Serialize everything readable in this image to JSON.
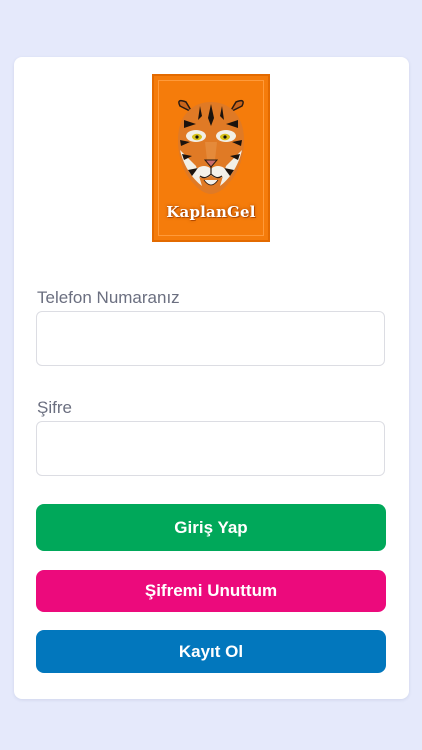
{
  "logo": {
    "text": "KaplanGel",
    "icon": "tiger-logo-icon",
    "bg_color": "#f57c0b"
  },
  "form": {
    "phone_label": "Telefon Numaranız",
    "phone_value": "",
    "password_label": "Şifre",
    "password_value": ""
  },
  "buttons": {
    "login": {
      "label": "Giriş Yap",
      "color": "#00a85a"
    },
    "forgot": {
      "label": "Şifremi Unuttum",
      "color": "#ec0a7c"
    },
    "register": {
      "label": "Kayıt Ol",
      "color": "#0277bd"
    }
  },
  "colors": {
    "background": "#e5e9fb",
    "card": "#ffffff",
    "label": "#6b6f80"
  }
}
